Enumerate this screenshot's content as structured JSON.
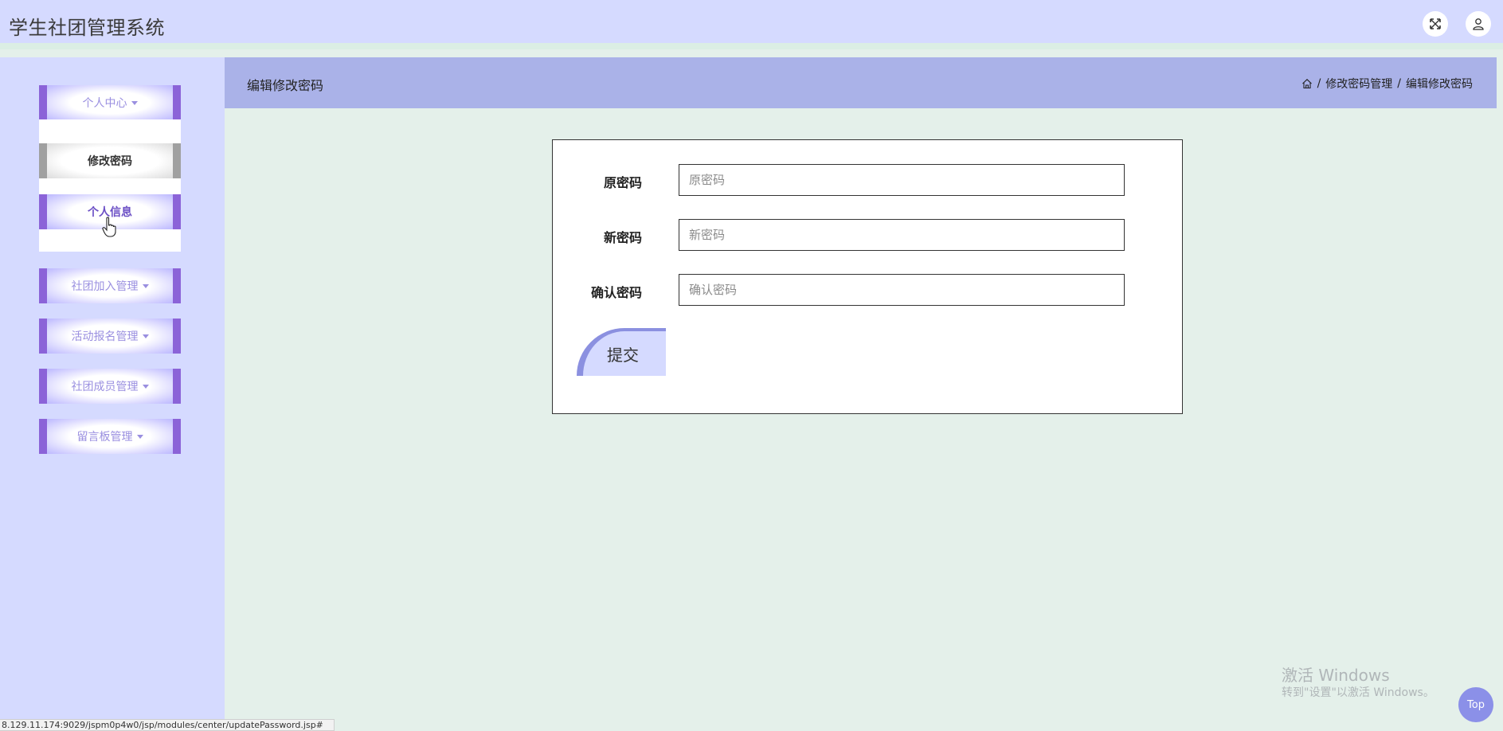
{
  "header": {
    "title": "学生社团管理系统",
    "fullscreen_icon": "fullscreen-icon",
    "user_icon": "user-icon"
  },
  "sidebar": {
    "menus": [
      {
        "label": "个人中心",
        "icon": "caret-down-icon"
      },
      {
        "label": "社团加入管理",
        "icon": "caret-down-icon"
      },
      {
        "label": "活动报名管理",
        "icon": "caret-down-icon"
      },
      {
        "label": "社团成员管理",
        "icon": "caret-down-icon"
      },
      {
        "label": "留言板管理",
        "icon": "caret-down-icon"
      }
    ],
    "submenu": [
      {
        "label": "修改密码",
        "state": "active"
      },
      {
        "label": "个人信息",
        "state": "hover"
      }
    ]
  },
  "content": {
    "heading": "编辑修改密码",
    "breadcrumb": {
      "home_icon": "home-icon",
      "separator": "/",
      "level1": "修改密码管理",
      "level2": "编辑修改密码"
    },
    "form": {
      "fields": [
        {
          "label": "原密码",
          "placeholder": "原密码",
          "value": ""
        },
        {
          "label": "新密码",
          "placeholder": "新密码",
          "value": ""
        },
        {
          "label": "确认密码",
          "placeholder": "确认密码",
          "value": ""
        }
      ],
      "submit_label": "提交"
    }
  },
  "watermark": {
    "line1": "激活 Windows",
    "line2": "转到\"设置\"以激活 Windows。"
  },
  "back_to_top": "Top",
  "status_bar_url": "8.129.11.174:9029/jspm0p4w0/jsp/modules/center/updatePassword.jsp#",
  "colors": {
    "header_bg": "#d5daff",
    "accent_purple": "#8b63d8",
    "crumb_bar_bg": "#aab2e8",
    "content_bg": "#e4f0ea"
  }
}
